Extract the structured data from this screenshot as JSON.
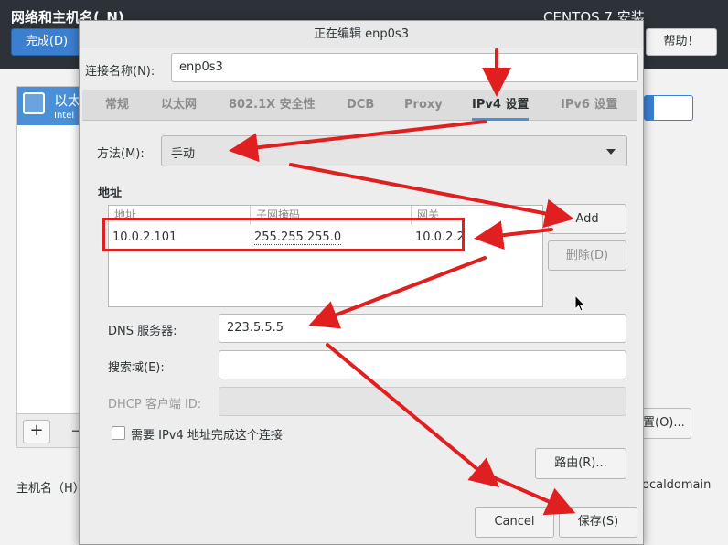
{
  "topbar": {
    "spoke_title": "网络和主机名(_N)",
    "install_title": "CENTOS 7 安装",
    "done_label": "完成(D)",
    "help_label": "帮助！"
  },
  "background": {
    "device_label": "以太",
    "device_sub": "Intel",
    "plus_label": "+",
    "minus_label": "−",
    "hostname_label": "主机名（H）",
    "configure_label": "置(O)...",
    "domain_text": "ocaldomain"
  },
  "dialog": {
    "title": "正在编辑 enp0s3",
    "connection_name_label": "连接名称(N):",
    "connection_name_value": "enp0s3",
    "tabs": [
      {
        "label": "常规"
      },
      {
        "label": "以太网"
      },
      {
        "label": "802.1X 安全性"
      },
      {
        "label": "DCB"
      },
      {
        "label": "Proxy"
      },
      {
        "label": "IPv4 设置"
      },
      {
        "label": "IPv6 设置"
      }
    ],
    "method_label": "方法(M):",
    "method_value": "手动",
    "addresses_label": "地址",
    "columns": [
      "地址",
      "子网掩码",
      "网关"
    ],
    "row": {
      "address": "10.0.2.101",
      "netmask": "255.255.255.0",
      "gateway": "10.0.2.2"
    },
    "add_label": "Add",
    "delete_label": "删除(D)",
    "dns_label": "DNS 服务器:",
    "dns_value": "223.5.5.5",
    "search_label": "搜索域(E):",
    "search_value": "",
    "dhcp_label": "DHCP 客户端 ID:",
    "dhcp_value": "",
    "require_ipv4_label": "需要 IPv4 地址完成这个连接",
    "routes_label": "路由(R)...",
    "cancel_label": "Cancel",
    "save_label": "保存(S)"
  },
  "colors": {
    "accent": "#4a90d9",
    "annotation_red": "#e02020"
  }
}
